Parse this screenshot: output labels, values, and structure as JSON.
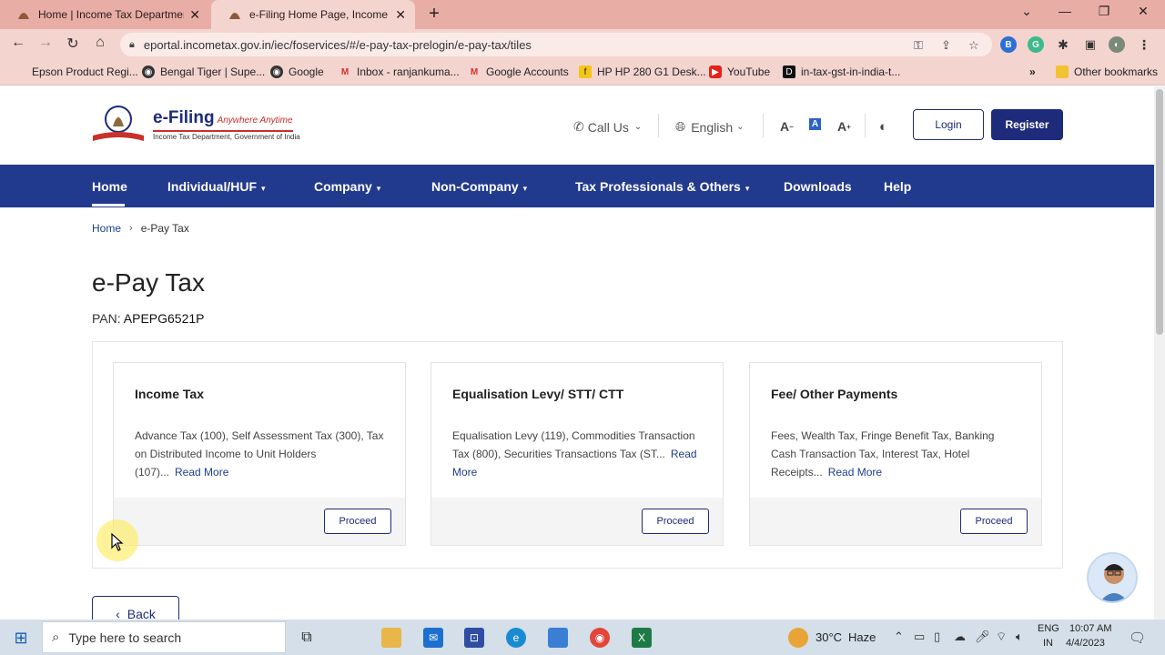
{
  "browser": {
    "tabs": [
      {
        "title": "Home | Income Tax Department"
      },
      {
        "title": "e-Filing Home Page, Income Tax"
      }
    ],
    "url": "eportal.incometax.gov.in/iec/foservices/#/e-pay-tax-prelogin/e-pay-tax/tiles",
    "bookmarks": [
      {
        "label": "Epson Product Regi..."
      },
      {
        "label": "Bengal Tiger | Supe..."
      },
      {
        "label": "Google"
      },
      {
        "label": "Inbox - ranjankuma..."
      },
      {
        "label": "Google Accounts"
      },
      {
        "label": "HP HP 280 G1 Desk..."
      },
      {
        "label": "YouTube"
      },
      {
        "label": "in-tax-gst-in-india-t..."
      }
    ],
    "more_bookmarks": "»",
    "other_bookmarks": "Other bookmarks"
  },
  "header": {
    "brand": "e-Filing",
    "tagline": "Anywhere Anytime",
    "subtitle": "Income Tax Department, Government of India",
    "call_us": "Call Us",
    "language": "English",
    "font_decrease": "A",
    "font_normal": "A",
    "font_increase": "A",
    "login": "Login",
    "register": "Register"
  },
  "nav": {
    "items": [
      {
        "label": "Home"
      },
      {
        "label": "Individual/HUF"
      },
      {
        "label": "Company"
      },
      {
        "label": "Non-Company"
      },
      {
        "label": "Tax Professionals & Others"
      },
      {
        "label": "Downloads"
      },
      {
        "label": "Help"
      }
    ]
  },
  "breadcrumb": {
    "home": "Home",
    "current": "e-Pay Tax"
  },
  "main": {
    "title": "e-Pay Tax",
    "pan_label": "PAN:",
    "pan_value": "APEPG6521P",
    "cards": [
      {
        "title": "Income Tax",
        "description": "Advance Tax (100), Self Assessment Tax (300), Tax on Distributed Income to Unit Holders (107)...",
        "read_more": "Read More",
        "button": "Proceed"
      },
      {
        "title": "Equalisation Levy/ STT/ CTT",
        "description": "Equalisation Levy (119), Commodities Transaction Tax (800), Securities Transactions Tax (ST...",
        "read_more": "Read More",
        "button": "Proceed"
      },
      {
        "title": "Fee/ Other Payments",
        "description": "Fees, Wealth Tax, Fringe Benefit Tax, Banking Cash Transaction Tax, Interest Tax, Hotel Receipts...",
        "read_more": "Read More",
        "button": "Proceed"
      }
    ],
    "back": "Back"
  },
  "taskbar": {
    "search_placeholder": "Type here to search",
    "weather_temp": "30°C",
    "weather_desc": "Haze",
    "lang_top": "ENG",
    "lang_bottom": "IN",
    "time": "10:07 AM",
    "date": "4/4/2023"
  },
  "colors": {
    "brand_navy": "#1d2b7a",
    "nav_blue": "#223a8e",
    "link_blue": "#1d3e8f",
    "chrome_tab": "#e8aea6",
    "taskbar": "#d4dfe9"
  }
}
